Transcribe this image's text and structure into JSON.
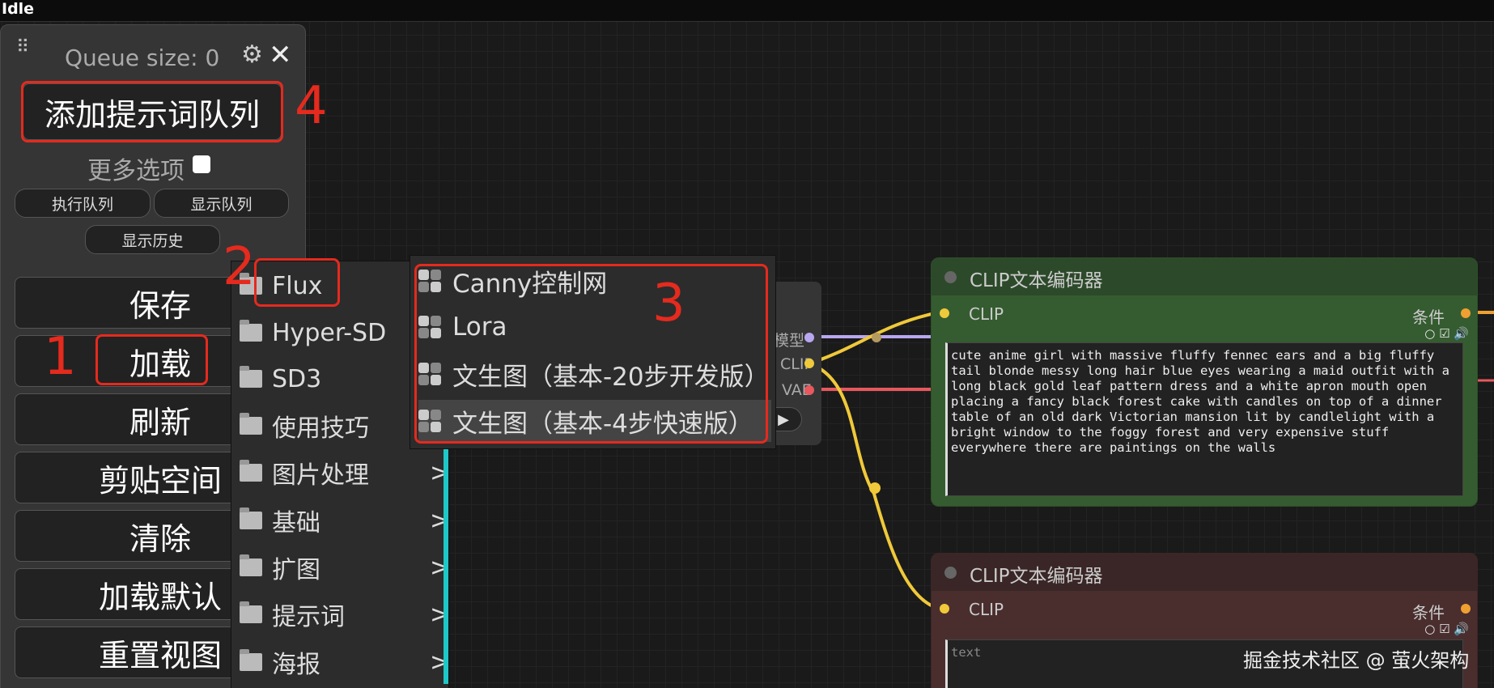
{
  "status": "Idle",
  "queue_panel": {
    "queue_size": "Queue size: 0",
    "queue_prompt": "添加提示词队列",
    "more_options": "更多选项",
    "run_queue": "执行队列",
    "show_queue": "显示队列",
    "show_history": "显示历史",
    "buttons": [
      "保存",
      "加载",
      "刷新",
      "剪贴空间",
      "清除",
      "加载默认",
      "重置视图"
    ]
  },
  "menu": {
    "items": [
      {
        "label": "Flux",
        "arrow": ""
      },
      {
        "label": "Hyper-SD",
        "arrow": ""
      },
      {
        "label": "SD3",
        "arrow": ""
      },
      {
        "label": "使用技巧",
        "arrow": ""
      },
      {
        "label": "图片处理",
        "arrow": ">"
      },
      {
        "label": "基础",
        "arrow": ">"
      },
      {
        "label": "扩图",
        "arrow": ">"
      },
      {
        "label": "提示词",
        "arrow": ">"
      },
      {
        "label": "海报",
        "arrow": ">"
      }
    ]
  },
  "submenu": {
    "items": [
      {
        "label": "Canny控制网"
      },
      {
        "label": "Lora"
      },
      {
        "label": "文生图（基本-20步开发版）"
      },
      {
        "label": "文生图（基本-4步快速版）"
      }
    ]
  },
  "hidden_node": {
    "labels": [
      "模型",
      "CLIP",
      "VAE"
    ]
  },
  "clip_nodes": [
    {
      "title": "CLIP文本编码器",
      "input": "CLIP",
      "output": "条件",
      "text": "cute anime girl with massive fluffy fennec ears and a big fluffy tail blonde messy long hair blue eyes wearing a maid outfit with a long black gold leaf pattern dress and a white apron mouth open placing a fancy black forest cake with candles on top of a dinner table of an old dark Victorian mansion lit by candlelight with a bright window to the foggy forest and very expensive stuff everywhere there are paintings on the walls"
    },
    {
      "title": "CLIP文本编码器",
      "input": "CLIP",
      "output": "条件",
      "placeholder": "text"
    }
  ],
  "annotations": [
    "1",
    "2",
    "3",
    "4"
  ],
  "watermark": "掘金技术社区 @ 萤火架构",
  "colors": {
    "annotation": "#e52a1e",
    "wire_clip": "#f0c93a",
    "wire_model": "#b8a6f0",
    "wire_vae": "#e8585e",
    "wire_out": "#f0a030",
    "node_positive": "#355c30",
    "node_negative": "#4a2e2e"
  }
}
